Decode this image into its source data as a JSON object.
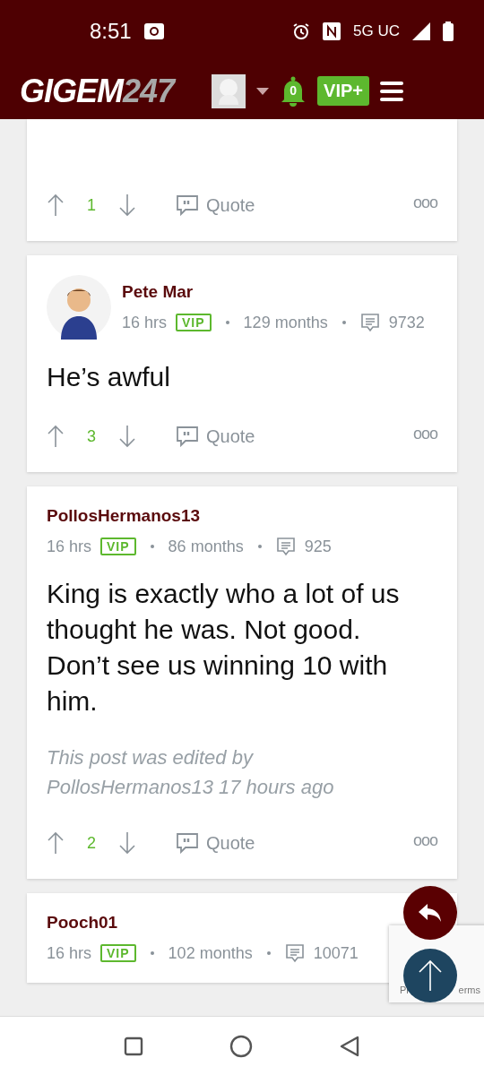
{
  "status_bar": {
    "time": "8:51",
    "network": "5G UC"
  },
  "header": {
    "logo_main": "GIGEM",
    "logo_accent": "247",
    "notifications": "0",
    "vip_button": "VIP+"
  },
  "posts": [
    {
      "kind": "partial",
      "votes": "1",
      "quote": "Quote",
      "more": "ooo"
    },
    {
      "kind": "full",
      "avatar": true,
      "author": "Pete Mar",
      "time": "16 hrs",
      "badge": "VIP",
      "tenure": "129 months",
      "post_count": "9732",
      "body": "He’s awful",
      "votes": "3",
      "quote": "Quote",
      "more": "ooo"
    },
    {
      "kind": "full",
      "avatar": false,
      "author": "PollosHermanos13",
      "time": "16 hrs",
      "badge": "VIP",
      "tenure": "86 months",
      "post_count": "925",
      "body": "King is exactly who a lot of us thought he was. Not good. Don’t see us winning 10 with him.",
      "edited_note": "This post was edited by PollosHermanos13 17 hours ago",
      "votes": "2",
      "quote": "Quote",
      "more": "ooo"
    },
    {
      "kind": "full",
      "avatar": false,
      "author": "Pooch01",
      "time": "16 hrs",
      "badge": "VIP",
      "tenure": "102 months",
      "post_count": "10071"
    }
  ],
  "recaptcha": {
    "left_text": "Pr",
    "right_text": "erms"
  }
}
